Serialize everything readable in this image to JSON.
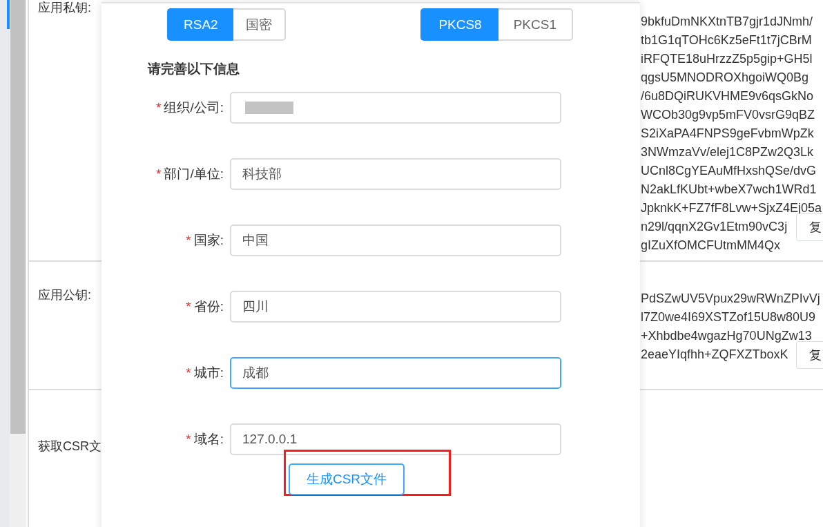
{
  "page": {
    "sections": [
      {
        "label": "应用私钥:",
        "lines": [
          {
            "text": "9bkfuDmNKXtnTB7gjr1dJNmh/"
          },
          {
            "text": "tb1G1qTOHc6Kz5eFt1t7jCBrM"
          },
          {
            "text": "iRFQTE18uHrzzZ5p5gip+GH5l"
          },
          {
            "text": "qgsU5MNODROXhgoiWQ0Bg"
          },
          {
            "text": "/6u8DQiRUKVHME9v6qsGkNo"
          },
          {
            "text": "WCOb30g9vp5mFV0vsrG9qBZ"
          },
          {
            "text": "S2iXaPA4FNPS9geFvbmWpZk"
          },
          {
            "text": "3NWmzaVv/elej1C8PZw2Q3Lk"
          },
          {
            "text": "UCnl8CgYEAuMfHxshQSe/dvG"
          },
          {
            "text": "N2akLfKUbt+wbeX7wch1WRd1"
          },
          {
            "text": "JpknkK+FZ7fF8Lvw+SjxZ4Ej05a"
          },
          {
            "text": "n29l/qqnX2Gv1Etm90vC3j",
            "copy_button": "复"
          },
          {
            "text": "gIZuXfOMCFUtmMM4Qx"
          }
        ]
      },
      {
        "label": "应用公钥:",
        "lines": [
          {
            "text": "PdSZwUV5Vpux29wRWnZPIvVj"
          },
          {
            "text": "l7Z0we4I69XSTZof15U8w80U9"
          },
          {
            "text": "+Xhbdbe4wgazHg70UNgZw13"
          },
          {
            "text": "2eaeYIqfhh+ZQFXZTboxK",
            "copy_button": "复"
          }
        ]
      },
      {
        "label": "获取CSR文"
      }
    ]
  },
  "dialog": {
    "algorithm": [
      {
        "label": "RSA2",
        "selected": true
      },
      {
        "label": "国密",
        "selected": false
      }
    ],
    "format": [
      {
        "label": "PKCS8",
        "selected": true
      },
      {
        "label": "PKCS1",
        "selected": false
      }
    ],
    "heading": "请完善以下信息",
    "fields": [
      {
        "marker": "*",
        "label": "组织/公司:",
        "redacted": true,
        "focused": false
      },
      {
        "marker": "*",
        "label": "部门/单位:",
        "value": "科技部",
        "redacted": false,
        "focused": false
      },
      {
        "marker": "*",
        "label": "国家:",
        "value": "中国",
        "redacted": false,
        "focused": false
      },
      {
        "marker": "*",
        "label": "省份:",
        "value": "四川",
        "redacted": false,
        "focused": false
      },
      {
        "marker": "*",
        "label": "城市:",
        "value": "成都",
        "redacted": false,
        "focused": true
      },
      {
        "marker": "*",
        "label": "域名:",
        "value": "127.0.0.1",
        "redacted": false,
        "focused": false
      }
    ],
    "submit": "生成CSR文件"
  }
}
